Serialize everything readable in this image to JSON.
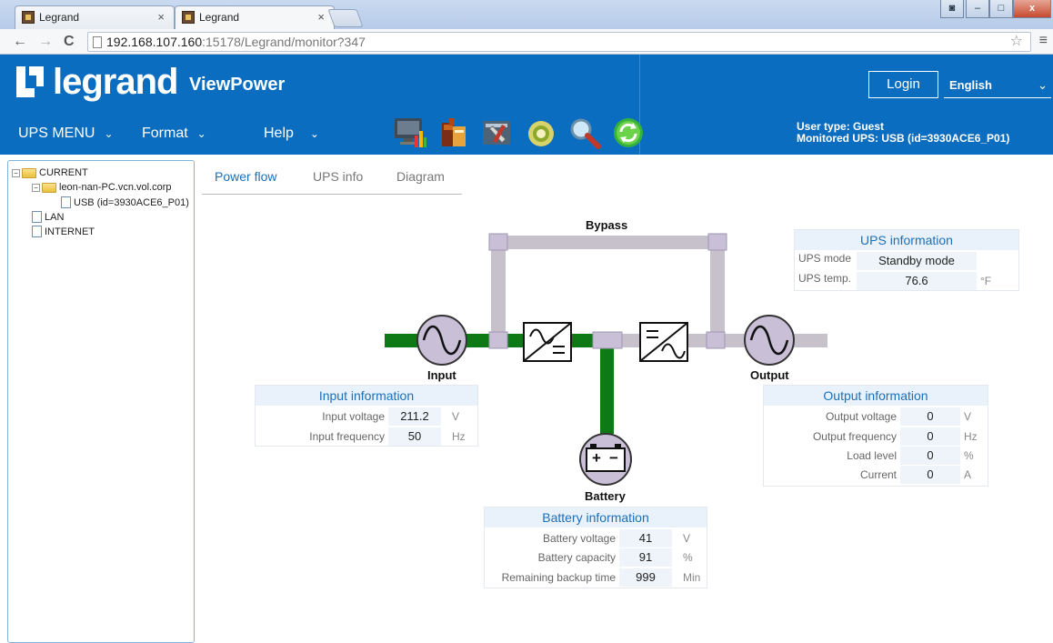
{
  "browser": {
    "tabs": [
      {
        "title": "Legrand",
        "close": "×"
      },
      {
        "title": "Legrand",
        "close": "×"
      }
    ],
    "url_host": "192.168.107.160",
    "url_rest": ":15178/Legrand/monitor?347",
    "back": "←",
    "forward": "→",
    "reload": "C",
    "star": "☆",
    "menu": "≡",
    "win_min": "–",
    "win_max": "□",
    "win_close": "x"
  },
  "header": {
    "logo_text": "legrand",
    "product": "ViewPower",
    "login_label": "Login",
    "language": "English",
    "lang_chevron": "⌄"
  },
  "nav": {
    "ups_menu": "UPS MENU",
    "format": "Format",
    "help": "Help",
    "chevron": "⌄",
    "user_type": "User type: Guest",
    "monitored_ups": "Monitored UPS: USB (id=3930ACE6_P01)"
  },
  "tree": {
    "current": "CURRENT",
    "host": "leon-nan-PC.vcn.vol.corp",
    "usb": "USB (id=3930ACE6_P01)",
    "lan": "LAN",
    "internet": "INTERNET",
    "collapse": "−"
  },
  "content_tabs": {
    "power_flow": "Power flow",
    "ups_info": "UPS info",
    "diagram": "Diagram"
  },
  "diagram": {
    "bypass": "Bypass",
    "input": "Input",
    "output": "Output",
    "battery": "Battery",
    "battery_plus": "+",
    "battery_minus": "−",
    "colors": {
      "active": "#0e7a16",
      "inactive": "#c7c1cb",
      "node": "#c9c0d8"
    }
  },
  "ups_information": {
    "title": "UPS information",
    "mode_label": "UPS mode",
    "mode_value": "Standby mode",
    "temp_label": "UPS temp.",
    "temp_value": "76.6",
    "temp_unit": "°F"
  },
  "input_information": {
    "title": "Input information",
    "voltage_label": "Input voltage",
    "voltage_value": "211.2",
    "voltage_unit": "V",
    "frequency_label": "Input frequency",
    "frequency_value": "50",
    "frequency_unit": "Hz"
  },
  "output_information": {
    "title": "Output information",
    "voltage_label": "Output voltage",
    "voltage_value": "0",
    "voltage_unit": "V",
    "frequency_label": "Output frequency",
    "frequency_value": "0",
    "frequency_unit": "Hz",
    "load_label": "Load level",
    "load_value": "0",
    "load_unit": "%",
    "current_label": "Current",
    "current_value": "0",
    "current_unit": "A"
  },
  "battery_information": {
    "title": "Battery information",
    "voltage_label": "Battery voltage",
    "voltage_value": "41",
    "voltage_unit": "V",
    "capacity_label": "Battery capacity",
    "capacity_value": "91",
    "capacity_unit": "%",
    "backup_label": "Remaining backup time",
    "backup_value": "999",
    "backup_unit": "Min"
  }
}
